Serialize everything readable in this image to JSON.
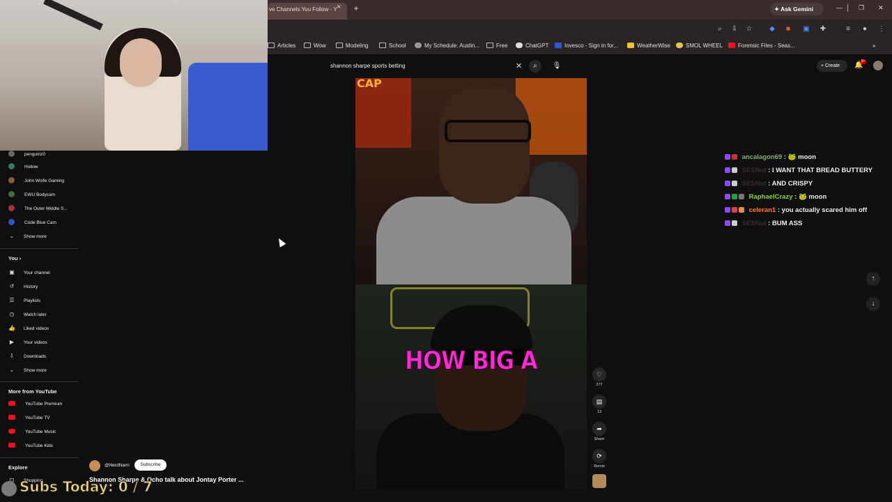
{
  "browser": {
    "tab_title": "ve Channels You Follow - Y",
    "tab_close": "×",
    "new_tab": "+",
    "ask_gemini": "✦ Ask Gemini",
    "bookmarks": [
      "Articles",
      "Wow",
      "Modeling",
      "School",
      "My Schedule: Austin...",
      "Free",
      "ChatGPT",
      "Invesco - Sign in for...",
      "WeatherWise",
      "SMOL WHEEL",
      "Forensic Files - Seas..."
    ],
    "bookmarks_more": "»"
  },
  "youtube": {
    "search_query": "shannon sharpe sports betting",
    "create_label": "Create",
    "notification_count": "9+",
    "sidebar": {
      "channels": [
        "penguinz0",
        "Hollow",
        "John Wolfe Gaming",
        "EWU Bodycam",
        "The Outer Middle S...",
        "Code Blue Cam"
      ],
      "show_more_1": "Show more",
      "you_heading": "You",
      "you_items": [
        "Your channel",
        "History",
        "Playlists",
        "Watch later",
        "Liked videos",
        "Your videos",
        "Downloads"
      ],
      "show_more_2": "Show more",
      "more_heading": "More from YouTube",
      "more_items": [
        "YouTube Premium",
        "YouTube TV",
        "YouTube Music",
        "YouTube Kids"
      ],
      "explore_heading": "Explore",
      "explore_items": [
        "Shopping"
      ]
    },
    "short": {
      "caption": "HOW BIG A",
      "cap_sign": "CAP",
      "likes": "277",
      "comments": "13",
      "share_label": "Share",
      "remix_label": "Remix",
      "channel_handle": "@NerdNami",
      "subscribe_label": "Subscribe",
      "title": "Shannon Sharpe & Ocho talk about Jontay Porter ..."
    }
  },
  "stream_overlay": {
    "subs_today": "Subs Today: 0 / 7"
  },
  "chat": [
    {
      "user": "ancalagon69",
      "user_color": "#7fb36a",
      "sep": " : ",
      "emote": "🐸",
      "message": " moon"
    },
    {
      "user": "SESNut",
      "user_color": "#3a2a28",
      "sep": " : ",
      "emote": "",
      "message": "I WANT THAT BREAD BUTTERY"
    },
    {
      "user": "SESNut",
      "user_color": "#3a2a28",
      "sep": " : ",
      "emote": "",
      "message": "AND CRISPY"
    },
    {
      "user": "RaphaelCrazy",
      "user_color": "#8fd13b",
      "sep": " : ",
      "emote": "🐸",
      "message": " moon"
    },
    {
      "user": "celeran1",
      "user_color": "#ff7a2e",
      "sep": " : ",
      "emote": "",
      "message": "you actually scared him off"
    },
    {
      "user": "SESNut",
      "user_color": "#3a2a28",
      "sep": " : ",
      "emote": "",
      "message": "BUM ASS"
    }
  ]
}
